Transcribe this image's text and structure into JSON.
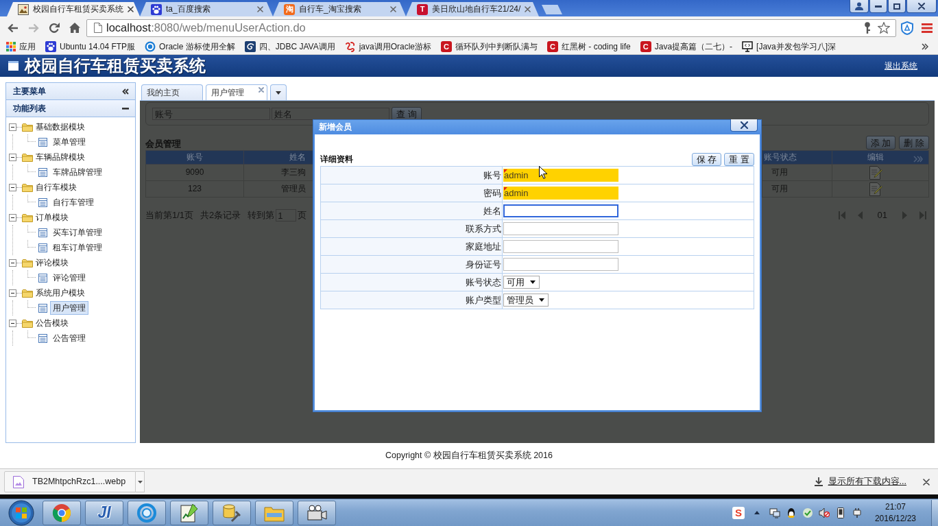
{
  "browser": {
    "tabs": [
      {
        "title": "校园自行车租赁买卖系统",
        "selected": true,
        "kind": "picture"
      },
      {
        "title": "ta_百度搜索",
        "selected": false,
        "kind": "paw"
      },
      {
        "title": "自行车_淘宝搜索",
        "selected": false,
        "kind": "tile",
        "favicon_text": "淘",
        "color": "#f26a1b"
      },
      {
        "title": "美日欣山地自行车21/24/",
        "selected": false,
        "kind": "tile",
        "favicon_text": "T",
        "color": "#c8102e"
      }
    ],
    "address": {
      "host": "localhost",
      "path": ":8080/web/menuUserAction.do"
    },
    "bookmarks": [
      {
        "label": "应用",
        "kind": "apps"
      },
      {
        "label": "Ubuntu 14.04 FTP服",
        "kind": "paw"
      },
      {
        "label": "Oracle 游标使用全解",
        "kind": "ring"
      },
      {
        "label": "四、JDBC JAVA调用",
        "kind": "swirl"
      },
      {
        "label": "java调用Oracle游标",
        "kind": "knot"
      },
      {
        "label": "循环队列中判断队满与",
        "kind": "tile",
        "icon_text": "C"
      },
      {
        "label": "红黑树 - coding life",
        "kind": "tile",
        "icon_text": "C"
      },
      {
        "label": "Java提高篇（二七）-",
        "kind": "tile",
        "icon_text": "C"
      },
      {
        "label": "[Java并发包学习八]深",
        "kind": "monitor"
      }
    ]
  },
  "app": {
    "title": "校园自行车租赁买卖系统",
    "logout": "退出系统"
  },
  "sidebar": {
    "title": "主要菜单",
    "section": "功能列表",
    "tree": [
      {
        "label": "基础数据模块",
        "expanded": true,
        "children": [
          {
            "label": "菜单管理",
            "selected": false
          }
        ]
      },
      {
        "label": "车辆品牌模块",
        "expanded": true,
        "children": [
          {
            "label": "车牌品牌管理",
            "selected": false
          }
        ]
      },
      {
        "label": "自行车模块",
        "expanded": true,
        "children": [
          {
            "label": "自行车管理",
            "selected": false
          }
        ]
      },
      {
        "label": "订单模块",
        "expanded": true,
        "children": [
          {
            "label": "买车订单管理",
            "selected": false
          },
          {
            "label": "租车订单管理",
            "selected": false
          }
        ]
      },
      {
        "label": "评论模块",
        "expanded": true,
        "children": [
          {
            "label": "评论管理",
            "selected": false
          }
        ]
      },
      {
        "label": "系统用户模块",
        "expanded": true,
        "children": [
          {
            "label": "用户管理",
            "selected": true
          }
        ]
      },
      {
        "label": "公告模块",
        "expanded": true,
        "children": [
          {
            "label": "公告管理",
            "selected": false
          }
        ]
      }
    ]
  },
  "content_tabs": [
    {
      "label": "我的主页",
      "selected": false,
      "closable": false
    },
    {
      "label": "用户管理",
      "selected": true,
      "closable": true
    }
  ],
  "search": {
    "fields": [
      {
        "placeholder": "账号"
      },
      {
        "placeholder": "姓名"
      }
    ],
    "button": "查 询"
  },
  "panel": {
    "title": "会员管理",
    "actions": [
      "添 加",
      "删 除"
    ]
  },
  "table": {
    "columns": [
      "账号",
      "姓名",
      "账号状态",
      "编辑"
    ],
    "rows": [
      {
        "cells": [
          "9090",
          "李三狗",
          "可用"
        ]
      },
      {
        "cells": [
          "123",
          "管理员",
          "可用"
        ]
      }
    ]
  },
  "pager": {
    "position": "当前第1/1页",
    "total": "共2条记录",
    "goto_prefix": "转到第",
    "goto_value": "1",
    "goto_suffix": "页",
    "page": "01"
  },
  "dialog": {
    "title": "新增会员",
    "section": "详细资料",
    "buttons": [
      "保 存",
      "重 置"
    ],
    "fields": [
      {
        "label": "账号",
        "kind": "text",
        "value": "admin",
        "invalid": true,
        "focused": false
      },
      {
        "label": "密码",
        "kind": "text",
        "value": "admin",
        "invalid": true,
        "focused": false
      },
      {
        "label": "姓名",
        "kind": "text",
        "invalid": false,
        "focused": true
      },
      {
        "label": "联系方式",
        "kind": "text",
        "invalid": false,
        "focused": false
      },
      {
        "label": "家庭地址",
        "kind": "text",
        "invalid": false,
        "focused": false
      },
      {
        "label": "身份证号",
        "kind": "text",
        "invalid": false,
        "focused": false
      },
      {
        "label": "账号状态",
        "kind": "select",
        "value": "可用",
        "invalid": false,
        "focused": false
      },
      {
        "label": "账户类型",
        "kind": "select",
        "value": "管理员",
        "invalid": false,
        "focused": false
      }
    ]
  },
  "footer": {
    "copyright": "Copyright © 校园自行车租赁买卖系统 2016"
  },
  "downloads": {
    "file": "TB2MhtpchRzc1....webp",
    "show_all": "显示所有下载内容..."
  },
  "taskbar": {
    "ide_label": "JI",
    "ime_label": "S",
    "time": "21:07",
    "date": "2016/12/23"
  }
}
